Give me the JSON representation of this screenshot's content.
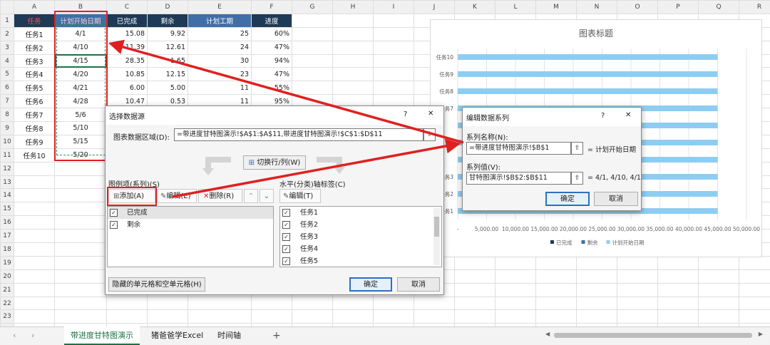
{
  "sheet": {
    "columns": [
      "A",
      "B",
      "C",
      "D",
      "E",
      "F",
      "G",
      "H",
      "I",
      "J",
      "K",
      "L",
      "M",
      "N",
      "O",
      "P",
      "Q",
      "R"
    ],
    "rows": [
      [
        "任务",
        "计划开始日期",
        "已完成",
        "剩余",
        "计划工期",
        "进度"
      ],
      [
        "任务1",
        "4/1",
        "15.08",
        "9.92",
        "25",
        "60%"
      ],
      [
        "任务2",
        "4/10",
        "11.39",
        "12.61",
        "24",
        "47%"
      ],
      [
        "任务3",
        "4/15",
        "28.35",
        "1.65",
        "30",
        "94%"
      ],
      [
        "任务4",
        "4/20",
        "10.85",
        "12.15",
        "23",
        "47%"
      ],
      [
        "任务5",
        "4/21",
        "6.00",
        "5.00",
        "11",
        "55%"
      ],
      [
        "任务6",
        "4/28",
        "10.47",
        "0.53",
        "11",
        "95%"
      ],
      [
        "任务7",
        "5/6",
        "",
        "",
        "",
        ""
      ],
      [
        "任务8",
        "5/10",
        "",
        "",
        "",
        ""
      ],
      [
        "任务9",
        "5/15",
        "",
        "",
        "",
        ""
      ],
      [
        "任务10",
        "5/20",
        "",
        "",
        "",
        ""
      ]
    ],
    "row_numbers": [
      "1",
      "2",
      "3",
      "4",
      "5",
      "6",
      "7",
      "8",
      "9",
      "10",
      "11",
      "12",
      "13",
      "14",
      "15",
      "16",
      "17",
      "18",
      "19",
      "20",
      "21",
      "22",
      "23",
      "24"
    ]
  },
  "chart": {
    "title": "图表标题",
    "legend": [
      {
        "name": "已完成",
        "color": "#1f3a56"
      },
      {
        "name": "剩余",
        "color": "#3f6fa6"
      },
      {
        "name": "计划开始日期",
        "color": "#8ecdf2"
      }
    ]
  },
  "chart_data": {
    "type": "bar",
    "orientation": "horizontal",
    "title": "图表标题",
    "categories": [
      "任务10",
      "任务9",
      "任务8",
      "任务7",
      "任务6",
      "任务5",
      "任务4",
      "任务3",
      "任务2",
      "任务1"
    ],
    "visible_categories": [
      "任务10",
      "任务9",
      "任务8",
      "任务7",
      "任务3",
      "任务2",
      "任务1"
    ],
    "series": [
      {
        "name": "已完成",
        "values": [
          0,
          0,
          0,
          0,
          10.47,
          6.0,
          10.85,
          28.35,
          11.39,
          15.08
        ]
      },
      {
        "name": "剩余",
        "values": [
          0,
          0,
          0,
          0,
          0.53,
          5.0,
          12.15,
          1.65,
          12.61,
          9.92
        ]
      },
      {
        "name": "计划开始日期",
        "values": [
          45000,
          45000,
          45000,
          45000,
          45000,
          45000,
          45000,
          45000,
          45000,
          45000
        ]
      }
    ],
    "x_ticks": [
      "-",
      "5,000.00",
      "10,000.00",
      "15,000.00",
      "20,000.00",
      "25,000.00",
      "30,000.00",
      "35,000.00",
      "40,000.00",
      "45,000.00",
      "50,000.00"
    ],
    "xlim": [
      0,
      50000
    ],
    "grid": true,
    "legend_position": "bottom"
  },
  "dialog_select": {
    "title": "选择数据源",
    "help": "?",
    "close": "✕",
    "range_label": "图表数据区域(D):",
    "range_value": "=带进度甘特图演示!$A$1:$A$11,带进度甘特图演示!$C$1:$D$11",
    "switch_label": "切换行/列(W)",
    "legend_label": "图例项(系列)(S)",
    "axis_label": "水平(分类)轴标签(C)",
    "add_label": "添加(A)",
    "edit_label": "编辑(E)",
    "delete_label": "删除(R)",
    "axis_edit_label": "编辑(T)",
    "series_items": [
      "已完成",
      "剩余"
    ],
    "axis_items": [
      "任务1",
      "任务2",
      "任务3",
      "任务4",
      "任务5"
    ],
    "hidden_label": "隐藏的单元格和空单元格(H)",
    "ok": "确定",
    "cancel": "取消"
  },
  "dialog_edit": {
    "title": "编辑数据系列",
    "help": "?",
    "close": "✕",
    "name_label": "系列名称(N):",
    "name_value": "=带进度甘特图演示!$B$1",
    "name_result": "= 计划开始日期",
    "values_label": "系列值(V):",
    "values_value": "甘特图演示!$B$2:$B$11",
    "values_result": "= 4/1, 4/10, 4/1",
    "ok": "确定",
    "cancel": "取消"
  },
  "tabs": {
    "active": "带进度甘特图演示",
    "others": [
      "猪爸爸学Excel",
      "时间轴"
    ],
    "add": "+"
  },
  "colors": {
    "arrow": "#e02020",
    "selection": "#1e7145",
    "bar": "#8ecdf2"
  }
}
